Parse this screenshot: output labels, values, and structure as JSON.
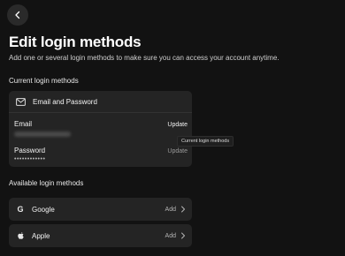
{
  "header": {
    "back_icon": "chevron-left-icon",
    "title": "Edit login methods",
    "subtitle": "Add one or several login methods to make sure you can access your account anytime."
  },
  "current": {
    "section_label": "Current login methods",
    "card_title": "Email and Password",
    "card_icon": "mail-icon",
    "email": {
      "title": "Email",
      "action": "Update"
    },
    "password": {
      "title": "Password",
      "value": "••••••••••••",
      "action": "Update"
    },
    "tooltip": "Current login methods"
  },
  "available": {
    "section_label": "Available login methods",
    "methods": [
      {
        "icon": "google-icon",
        "glyph": "G",
        "label": "Google",
        "action": "Add"
      },
      {
        "icon": "apple-icon",
        "glyph": "",
        "label": "Apple",
        "action": "Add"
      }
    ]
  },
  "colors": {
    "background": "#121212",
    "card": "#242424",
    "text": "#ffffff",
    "muted": "#9a9a9a"
  }
}
